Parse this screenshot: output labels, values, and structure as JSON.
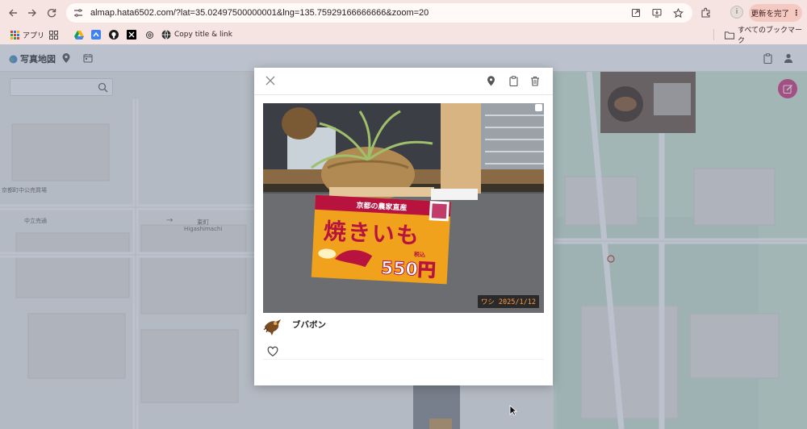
{
  "browser": {
    "url": "almap.hata6502.com/?lat=35.02497500000001&lng=135.75929166666666&zoom=20",
    "update_button": "更新を完了",
    "profile_initial": "i",
    "nav": {
      "back_icon": "back-arrow-icon",
      "forward_icon": "forward-arrow-icon",
      "reload_icon": "reload-icon"
    }
  },
  "bookmarks": {
    "items": [
      {
        "label": "アプリ",
        "icon": "apps-grid-icon"
      },
      {
        "label": "",
        "icon": "grid-icon"
      },
      {
        "label": "",
        "icon": "drive-icon"
      },
      {
        "label": "",
        "icon": "app-icon"
      },
      {
        "label": "",
        "icon": "github-icon"
      },
      {
        "label": "",
        "icon": "x-icon"
      },
      {
        "label": "",
        "icon": "openai-icon"
      },
      {
        "label": "Copy title & link",
        "icon": "globe-icon"
      }
    ],
    "all_bookmarks": "すべてのブックマーク"
  },
  "app": {
    "title": "写真地図",
    "header_icons": [
      "location-pin-icon",
      "calendar-icon",
      "clipboard-icon",
      "person-icon"
    ]
  },
  "map": {
    "labels": [
      {
        "text": "京都町中公売買場"
      },
      {
        "text": "中立売通"
      },
      {
        "text": "東町"
      },
      {
        "text": "Higashimachi"
      }
    ]
  },
  "modal": {
    "author_name": "ブバボン",
    "photo_date": "ワシ 2025/1/12",
    "sign": {
      "line1": "京都の農家直産",
      "line2": "焼きいも",
      "price": "550円",
      "tax": "税込"
    }
  },
  "colors": {
    "fab": "#d63a7e",
    "chrome": "#f6e4e2",
    "overlay": "rgba(95,110,135,0.42)",
    "date_stamp": "#ff9a3c",
    "sign_orange": "#f0a21c",
    "sign_red": "#b8123f"
  }
}
